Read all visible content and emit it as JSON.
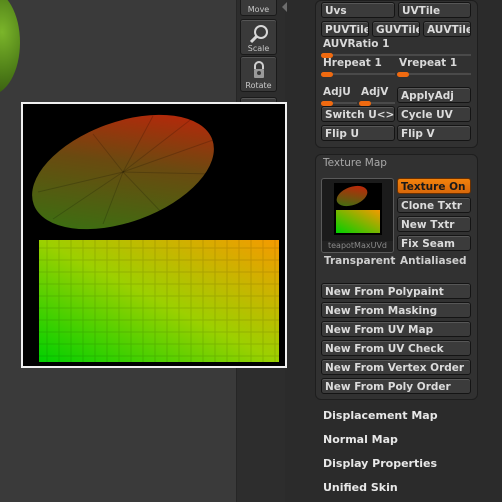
{
  "toolbar": {
    "move_label": "Move",
    "scale_label": "Scale",
    "rotate_label": "Rotate"
  },
  "uv_panel": {
    "uvs": "Uvs",
    "uvtile": "UVTile",
    "puvtiles": "PUVTiles",
    "guvtiles": "GUVTiles",
    "auvtiles": "AUVTiles",
    "auvratio": "AUVRatio 1",
    "hrepeat": "Hrepeat 1",
    "vrepeat": "Vrepeat 1",
    "adju": "AdjU",
    "adjv": "AdjV",
    "applyadj": "ApplyAdj",
    "switch_uv": "Switch U<>V",
    "cycle_uv": "Cycle UV",
    "flip_u": "Flip U",
    "flip_v": "Flip V"
  },
  "texture_map": {
    "header": "Texture Map",
    "thumbnail_label": "teapotMaxUVd",
    "texture_on": "Texture On",
    "clone_txtr": "Clone Txtr",
    "new_txtr": "New Txtr",
    "fix_seam": "Fix Seam",
    "transparent": "Transparent",
    "antialiased": "Antialiased",
    "new_from": [
      "New From Polypaint",
      "New From Masking",
      "New From UV Map",
      "New From UV Check",
      "New From Vertex Order",
      "New From Poly Order"
    ]
  },
  "subpalettes": [
    "Displacement Map",
    "Normal Map",
    "Display Properties",
    "Unified Skin"
  ],
  "colors": {
    "accent": "#f2820c",
    "panel": "#313131",
    "background": "#2b2b2b"
  }
}
